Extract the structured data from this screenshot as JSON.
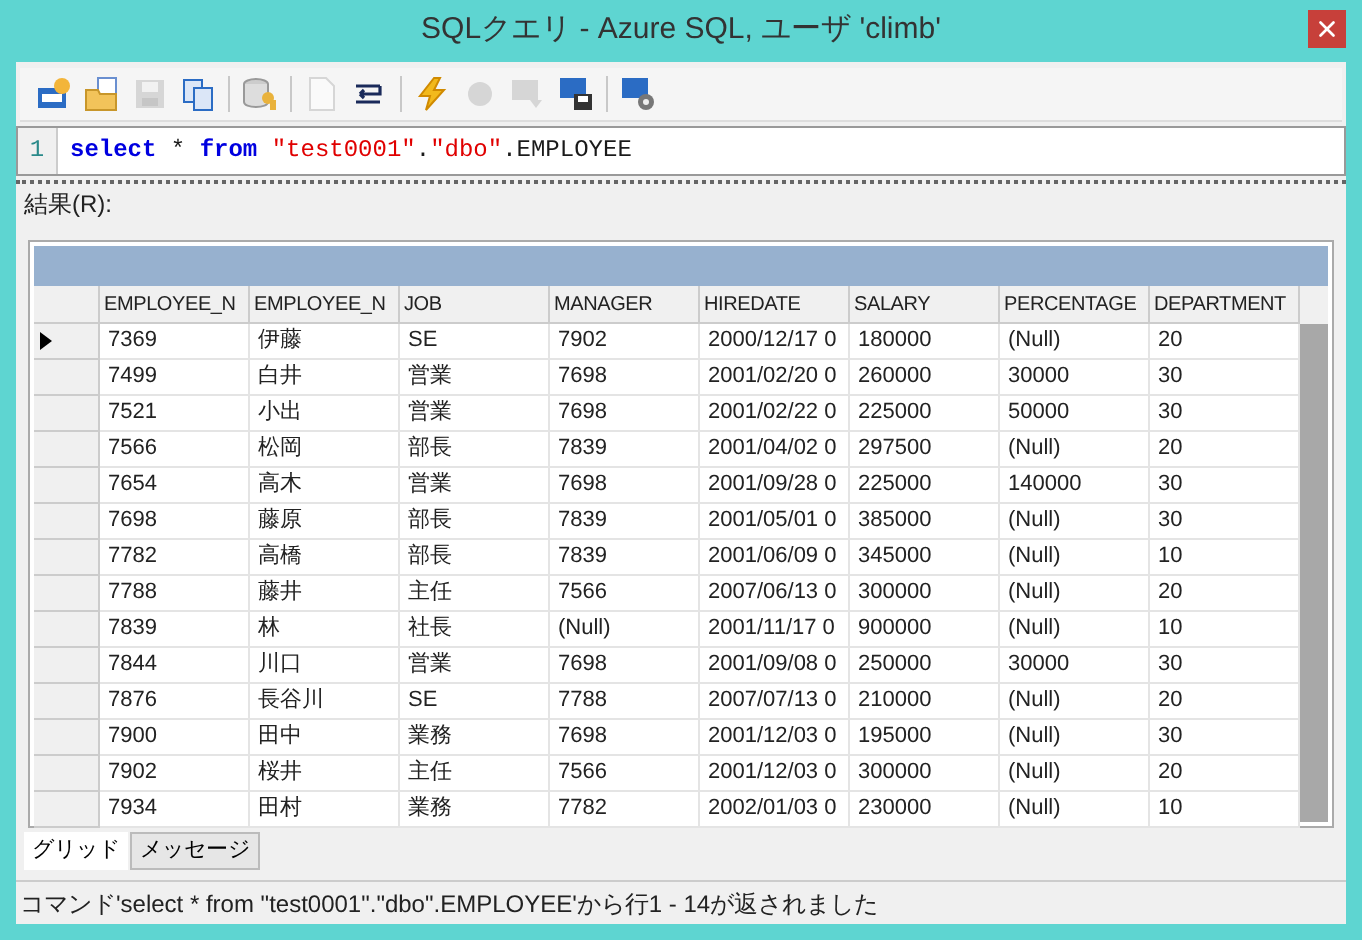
{
  "window": {
    "title": "SQLクエリ - Azure SQL, ユーザ 'climb'"
  },
  "toolbar": [
    {
      "kind": "new-sql",
      "disabled": false
    },
    {
      "kind": "open",
      "disabled": false
    },
    {
      "kind": "save",
      "disabled": true
    },
    {
      "kind": "copy",
      "disabled": false
    },
    {
      "kind": "sep"
    },
    {
      "kind": "db-key",
      "disabled": false
    },
    {
      "kind": "sep"
    },
    {
      "kind": "page",
      "disabled": true
    },
    {
      "kind": "wrap",
      "disabled": false
    },
    {
      "kind": "sep"
    },
    {
      "kind": "run",
      "disabled": false
    },
    {
      "kind": "stop",
      "disabled": true
    },
    {
      "kind": "sql-arrow",
      "disabled": true
    },
    {
      "kind": "sql-save",
      "disabled": false
    },
    {
      "kind": "sep"
    },
    {
      "kind": "sql-gear",
      "disabled": false
    }
  ],
  "editor": {
    "line_number": "1",
    "tokens": [
      {
        "text": "select",
        "kind": "keyword"
      },
      {
        "text": " * ",
        "kind": "plain"
      },
      {
        "text": "from",
        "kind": "keyword"
      },
      {
        "text": " \"test0001\"",
        "kind": "string"
      },
      {
        "text": ".",
        "kind": "plain"
      },
      {
        "text": "\"dbo\"",
        "kind": "string"
      },
      {
        "text": ".EMPLOYEE",
        "kind": "plain"
      }
    ]
  },
  "result_label": "結果(R):",
  "table": {
    "columns": [
      "EMPLOYEE_N",
      "EMPLOYEE_N",
      "JOB",
      "MANAGER",
      "HIREDATE",
      "SALARY",
      "PERCENTAGE",
      "DEPARTMENT"
    ],
    "rows": [
      {
        "current": true,
        "cells": [
          "7369",
          "伊藤",
          "SE",
          "7902",
          "2000/12/17 0",
          "180000",
          "(Null)",
          "20"
        ]
      },
      {
        "current": false,
        "cells": [
          "7499",
          "白井",
          "営業",
          "7698",
          "2001/02/20 0",
          "260000",
          "30000",
          "30"
        ]
      },
      {
        "current": false,
        "cells": [
          "7521",
          "小出",
          "営業",
          "7698",
          "2001/02/22 0",
          "225000",
          "50000",
          "30"
        ]
      },
      {
        "current": false,
        "cells": [
          "7566",
          "松岡",
          "部長",
          "7839",
          "2001/04/02 0",
          "297500",
          "(Null)",
          "20"
        ]
      },
      {
        "current": false,
        "cells": [
          "7654",
          "高木",
          "営業",
          "7698",
          "2001/09/28 0",
          "225000",
          "140000",
          "30"
        ]
      },
      {
        "current": false,
        "cells": [
          "7698",
          "藤原",
          "部長",
          "7839",
          "2001/05/01 0",
          "385000",
          "(Null)",
          "30"
        ]
      },
      {
        "current": false,
        "cells": [
          "7782",
          "高橋",
          "部長",
          "7839",
          "2001/06/09 0",
          "345000",
          "(Null)",
          "10"
        ]
      },
      {
        "current": false,
        "cells": [
          "7788",
          "藤井",
          "主任",
          "7566",
          "2007/06/13 0",
          "300000",
          "(Null)",
          "20"
        ]
      },
      {
        "current": false,
        "cells": [
          "7839",
          "林",
          "社長",
          "(Null)",
          "2001/11/17 0",
          "900000",
          "(Null)",
          "10"
        ]
      },
      {
        "current": false,
        "cells": [
          "7844",
          "川口",
          "営業",
          "7698",
          "2001/09/08 0",
          "250000",
          "30000",
          "30"
        ]
      },
      {
        "current": false,
        "cells": [
          "7876",
          "長谷川",
          "SE",
          "7788",
          "2007/07/13 0",
          "210000",
          "(Null)",
          "20"
        ]
      },
      {
        "current": false,
        "cells": [
          "7900",
          "田中",
          "業務",
          "7698",
          "2001/12/03 0",
          "195000",
          "(Null)",
          "30"
        ]
      },
      {
        "current": false,
        "cells": [
          "7902",
          "桜井",
          "主任",
          "7566",
          "2001/12/03 0",
          "300000",
          "(Null)",
          "20"
        ]
      },
      {
        "current": false,
        "cells": [
          "7934",
          "田村",
          "業務",
          "7782",
          "2002/01/03 0",
          "230000",
          "(Null)",
          "10"
        ]
      }
    ]
  },
  "tabs": [
    {
      "label": "グリッド",
      "selected": true
    },
    {
      "label": "メッセージ",
      "selected": false
    }
  ],
  "status_bar": "コマンド'select * from \"test0001\".\"dbo\".EMPLOYEE'から行1 - 14が返されました"
}
